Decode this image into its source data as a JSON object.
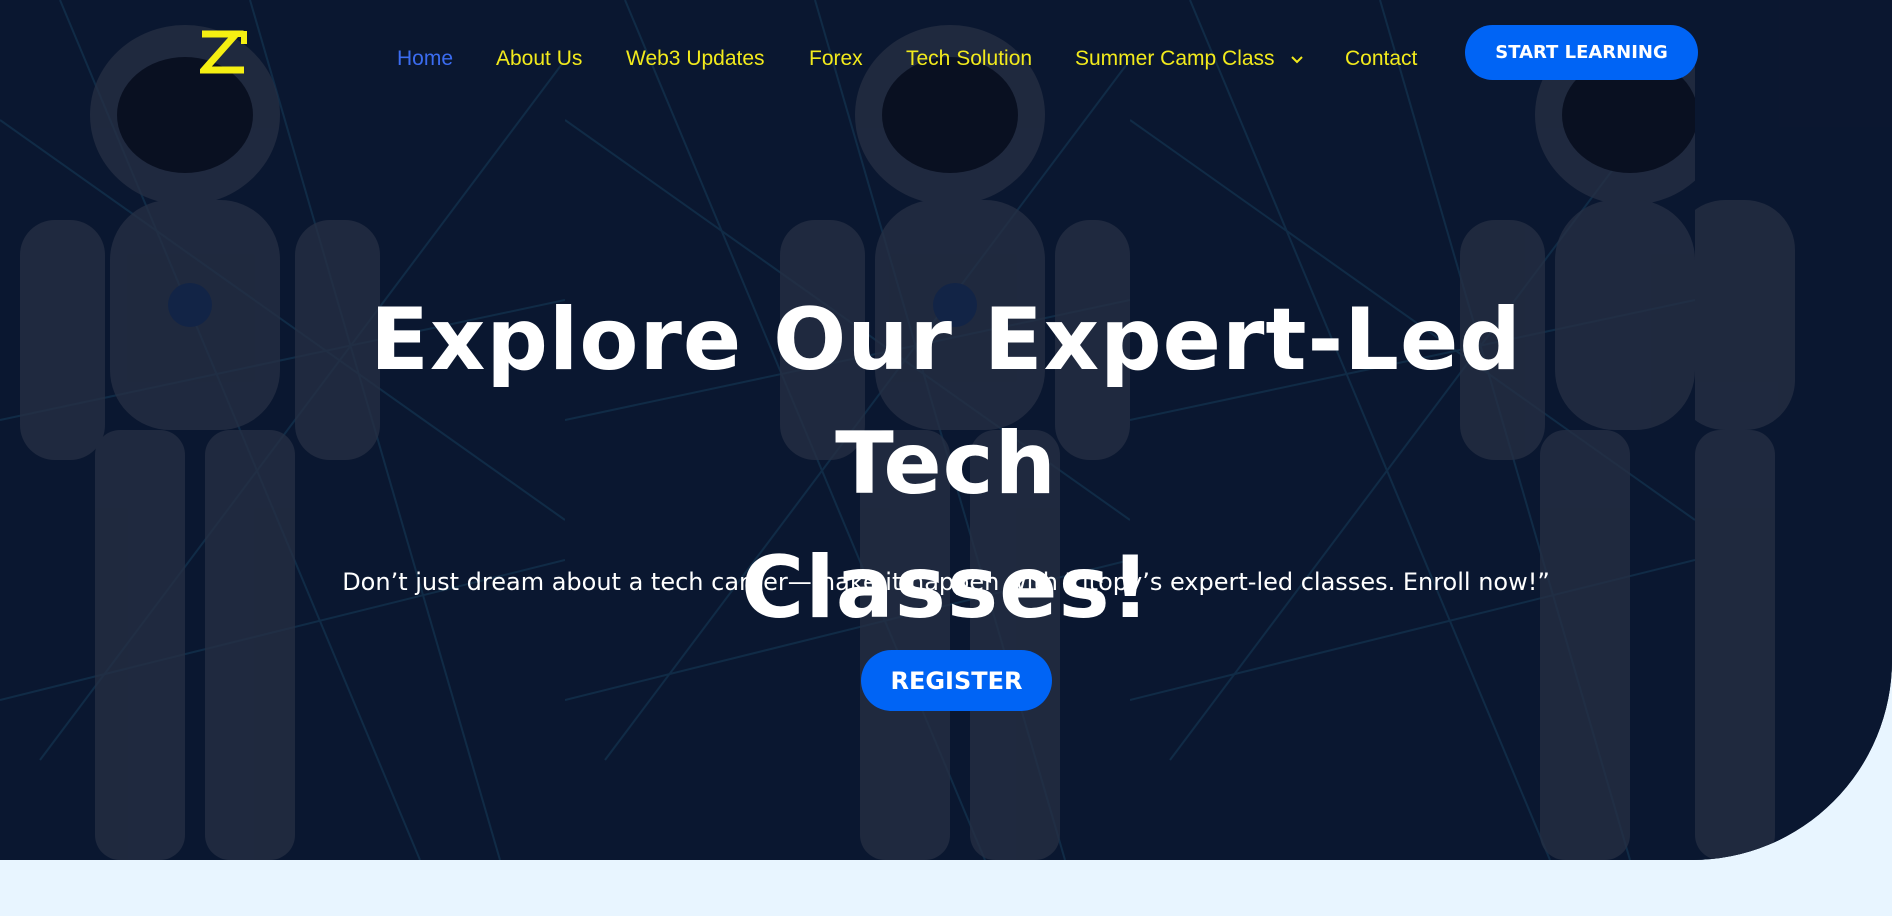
{
  "colors": {
    "accent": "#0064f5",
    "nav_text": "#f2ea1c",
    "nav_active": "#3b6cf0",
    "page_bg": "#e8f5ff"
  },
  "logo": {
    "icon": "zitopy-logo-icon"
  },
  "nav": {
    "items": [
      {
        "label": "Home",
        "active": true
      },
      {
        "label": "About Us"
      },
      {
        "label": "Web3 Updates"
      },
      {
        "label": "Forex"
      },
      {
        "label": "Tech Solution"
      },
      {
        "label": "Summer Camp Class",
        "icon": "chevron-down-icon"
      },
      {
        "label": "Contact"
      }
    ],
    "cta": "START LEARNING"
  },
  "hero": {
    "headline_line1": "Explore Our Expert-Led Tech",
    "headline_line2": "Classes!",
    "subtitle": "Don’t just dream about a tech career—make it happen with Zitopy’s expert-led classes. Enroll now!”",
    "button": "REGISTER",
    "background": "robot-background-image"
  }
}
